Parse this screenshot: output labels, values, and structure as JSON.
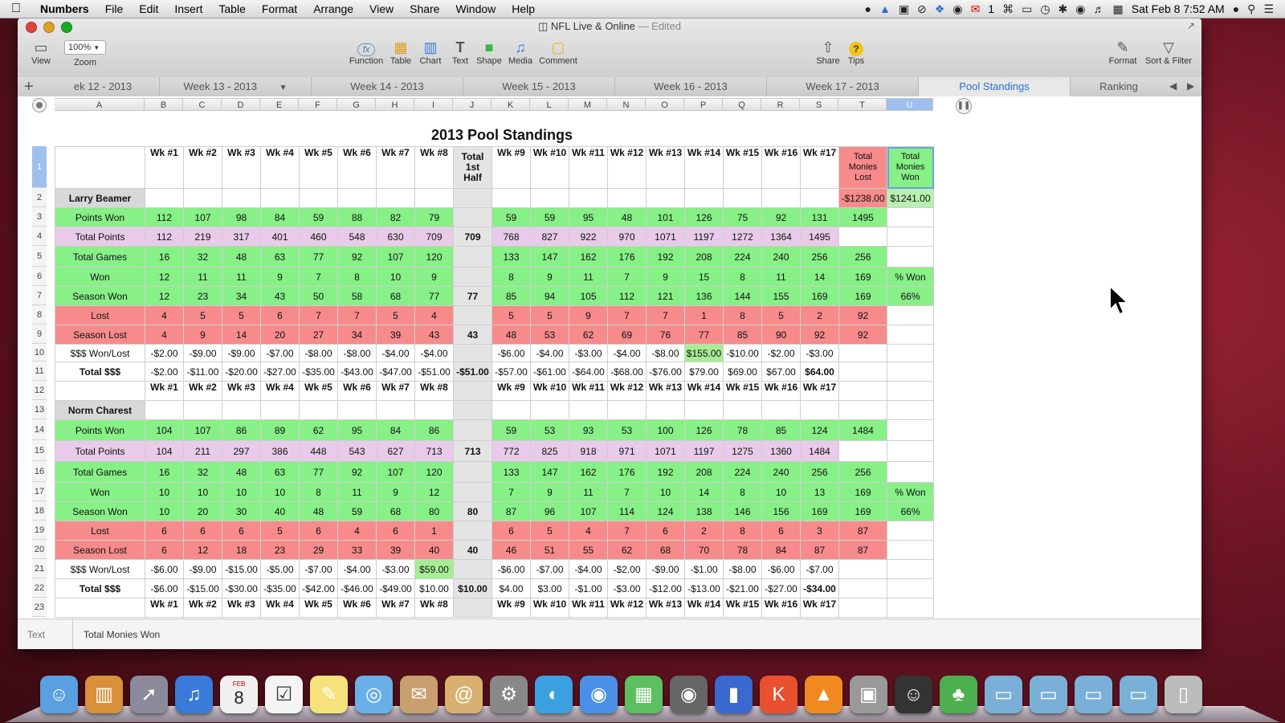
{
  "menubar": {
    "app": "Numbers",
    "items": [
      "File",
      "Edit",
      "Insert",
      "Table",
      "Format",
      "Arrange",
      "View",
      "Share",
      "Window",
      "Help"
    ],
    "badge": "1",
    "clock": "Sat Feb 8  7:52 AM"
  },
  "window": {
    "title": "NFL Live & Online",
    "edited": "— Edited"
  },
  "toolbar": {
    "view": "View",
    "zoom_value": "100%",
    "zoom": "Zoom",
    "function": "Function",
    "table": "Table",
    "chart": "Chart",
    "text": "Text",
    "shape": "Shape",
    "media": "Media",
    "comment": "Comment",
    "share": "Share",
    "tips": "Tips",
    "format": "Format",
    "sort_filter": "Sort & Filter",
    "fx": "fx"
  },
  "tabs": [
    "ek 12 - 2013",
    "Week 13 - 2013",
    "Week 14 - 2013",
    "Week 15 - 2013",
    "Week 16 - 2013",
    "Week 17 - 2013",
    "Pool Standings",
    "Ranking"
  ],
  "columns": [
    "A",
    "B",
    "C",
    "D",
    "E",
    "F",
    "G",
    "H",
    "I",
    "J",
    "K",
    "L",
    "M",
    "N",
    "O",
    "P",
    "Q",
    "R",
    "S",
    "T",
    "U"
  ],
  "row_numbers": [
    "1",
    "2",
    "3",
    "4",
    "5",
    "6",
    "7",
    "8",
    "9",
    "10",
    "11",
    "12",
    "13",
    "14",
    "15",
    "16",
    "17",
    "18",
    "19",
    "20",
    "21",
    "22",
    "23"
  ],
  "sheet_title": "2013 Pool Standings",
  "header_row": {
    "weeks_first": [
      "Wk #1",
      "Wk #2",
      "Wk #3",
      "Wk #4",
      "Wk #5",
      "Wk #6",
      "Wk #7",
      "Wk #8"
    ],
    "total_half_1": "Total",
    "total_half_2": "1st",
    "total_half_3": "Half",
    "weeks_second": [
      "Wk #9",
      "Wk #10",
      "Wk #11",
      "Wk #12",
      "Wk #13",
      "Wk #14",
      "Wk #15",
      "Wk #16",
      "Wk #17"
    ],
    "lost_1": "Total",
    "lost_2": "Monies",
    "lost_3": "Lost",
    "won_1": "Total",
    "won_2": "Monies",
    "won_3": "Won"
  },
  "player1": {
    "name": "Larry Beamer",
    "monies_lost": "-$1238.00",
    "monies_won": "$1241.00",
    "rows": {
      "points_won": {
        "label": "Points Won",
        "a": [
          "112",
          "107",
          "98",
          "84",
          "59",
          "88",
          "82",
          "79"
        ],
        "j": "",
        "b": [
          "59",
          "59",
          "95",
          "48",
          "101",
          "126",
          "75",
          "92",
          "131"
        ],
        "t": "1495",
        "u": ""
      },
      "total_points": {
        "label": "Total Points",
        "a": [
          "112",
          "219",
          "317",
          "401",
          "460",
          "548",
          "630",
          "709"
        ],
        "j": "709",
        "b": [
          "768",
          "827",
          "922",
          "970",
          "1071",
          "1197",
          "1272",
          "1364",
          "1495"
        ],
        "t": "",
        "u": ""
      },
      "total_games": {
        "label": "Total Games",
        "a": [
          "16",
          "32",
          "48",
          "63",
          "77",
          "92",
          "107",
          "120"
        ],
        "j": "",
        "b": [
          "133",
          "147",
          "162",
          "176",
          "192",
          "208",
          "224",
          "240",
          "256"
        ],
        "t": "256",
        "u": ""
      },
      "won": {
        "label": "Won",
        "a": [
          "12",
          "11",
          "11",
          "9",
          "7",
          "8",
          "10",
          "9"
        ],
        "j": "",
        "b": [
          "8",
          "9",
          "11",
          "7",
          "9",
          "15",
          "8",
          "11",
          "14"
        ],
        "t": "169",
        "u": "% Won"
      },
      "season_won": {
        "label": "Season Won",
        "a": [
          "12",
          "23",
          "34",
          "43",
          "50",
          "58",
          "68",
          "77"
        ],
        "j": "77",
        "b": [
          "85",
          "94",
          "105",
          "112",
          "121",
          "136",
          "144",
          "155",
          "169"
        ],
        "t": "169",
        "u": "66%"
      },
      "lost": {
        "label": "Lost",
        "a": [
          "4",
          "5",
          "5",
          "6",
          "7",
          "7",
          "5",
          "4"
        ],
        "j": "",
        "b": [
          "5",
          "5",
          "9",
          "7",
          "7",
          "1",
          "8",
          "5",
          "2"
        ],
        "t": "92",
        "u": ""
      },
      "season_lost": {
        "label": "Season Lost",
        "a": [
          "4",
          "9",
          "14",
          "20",
          "27",
          "34",
          "39",
          "43"
        ],
        "j": "43",
        "b": [
          "48",
          "53",
          "62",
          "69",
          "76",
          "77",
          "85",
          "90",
          "92"
        ],
        "t": "92",
        "u": ""
      },
      "won_lost": {
        "label": "$$$ Won/Lost",
        "a": [
          "-$2.00",
          "-$9.00",
          "-$9.00",
          "-$7.00",
          "-$8.00",
          "-$8.00",
          "-$4.00",
          "-$4.00"
        ],
        "j": "",
        "b": [
          "-$6.00",
          "-$4.00",
          "-$3.00",
          "-$4.00",
          "-$8.00",
          "$155.00",
          "-$10.00",
          "-$2.00",
          "-$3.00"
        ],
        "t": "",
        "u": ""
      },
      "total_money": {
        "label": "Total $$$",
        "a": [
          "-$2.00",
          "-$11.00",
          "-$20.00",
          "-$27.00",
          "-$35.00",
          "-$43.00",
          "-$47.00",
          "-$51.00"
        ],
        "j": "-$51.00",
        "b": [
          "-$57.00",
          "-$61.00",
          "-$64.00",
          "-$68.00",
          "-$76.00",
          "$79.00",
          "$69.00",
          "$67.00",
          "$64.00"
        ],
        "t": "",
        "u": ""
      }
    }
  },
  "player2": {
    "name": "Norm Charest",
    "rows": {
      "points_won": {
        "label": "Points Won",
        "a": [
          "104",
          "107",
          "86",
          "89",
          "62",
          "95",
          "84",
          "86"
        ],
        "j": "",
        "b": [
          "59",
          "53",
          "93",
          "53",
          "100",
          "126",
          "78",
          "85",
          "124"
        ],
        "t": "1484",
        "u": ""
      },
      "total_points": {
        "label": "Total Points",
        "a": [
          "104",
          "211",
          "297",
          "386",
          "448",
          "543",
          "627",
          "713"
        ],
        "j": "713",
        "b": [
          "772",
          "825",
          "918",
          "971",
          "1071",
          "1197",
          "1275",
          "1360",
          "1484"
        ],
        "t": "",
        "u": ""
      },
      "total_games": {
        "label": "Total Games",
        "a": [
          "16",
          "32",
          "48",
          "63",
          "77",
          "92",
          "107",
          "120"
        ],
        "j": "",
        "b": [
          "133",
          "147",
          "162",
          "176",
          "192",
          "208",
          "224",
          "240",
          "256"
        ],
        "t": "256",
        "u": ""
      },
      "won": {
        "label": "Won",
        "a": [
          "10",
          "10",
          "10",
          "10",
          "8",
          "11",
          "9",
          "12"
        ],
        "j": "",
        "b": [
          "7",
          "9",
          "11",
          "7",
          "10",
          "14",
          "8",
          "10",
          "13"
        ],
        "t": "169",
        "u": "% Won"
      },
      "season_won": {
        "label": "Season Won",
        "a": [
          "10",
          "20",
          "30",
          "40",
          "48",
          "59",
          "68",
          "80"
        ],
        "j": "80",
        "b": [
          "87",
          "96",
          "107",
          "114",
          "124",
          "138",
          "146",
          "156",
          "169"
        ],
        "t": "169",
        "u": "66%"
      },
      "lost": {
        "label": "Lost",
        "a": [
          "6",
          "6",
          "6",
          "5",
          "6",
          "4",
          "6",
          "1"
        ],
        "j": "",
        "b": [
          "6",
          "5",
          "4",
          "7",
          "6",
          "2",
          "8",
          "6",
          "3"
        ],
        "t": "87",
        "u": ""
      },
      "season_lost": {
        "label": "Season Lost",
        "a": [
          "6",
          "12",
          "18",
          "23",
          "29",
          "33",
          "39",
          "40"
        ],
        "j": "40",
        "b": [
          "46",
          "51",
          "55",
          "62",
          "68",
          "70",
          "78",
          "84",
          "87"
        ],
        "t": "87",
        "u": ""
      },
      "won_lost": {
        "label": "$$$ Won/Lost",
        "a": [
          "-$6.00",
          "-$9.00",
          "-$15.00",
          "-$5.00",
          "-$7.00",
          "-$4.00",
          "-$3.00",
          "$59.00"
        ],
        "j": "",
        "b": [
          "-$6.00",
          "-$7.00",
          "-$4.00",
          "-$2.00",
          "-$9.00",
          "-$1.00",
          "-$8.00",
          "-$6.00",
          "-$7.00"
        ],
        "t": "",
        "u": ""
      },
      "total_money": {
        "label": "Total $$$",
        "a": [
          "-$6.00",
          "-$15.00",
          "-$30.00",
          "-$35.00",
          "-$42.00",
          "-$46.00",
          "-$49.00",
          "$10.00"
        ],
        "j": "$10.00",
        "b": [
          "$4.00",
          "$3.00",
          "-$1.00",
          "-$3.00",
          "-$12.00",
          "-$13.00",
          "-$21.00",
          "-$27.00",
          "-$34.00"
        ],
        "t": "",
        "u": ""
      }
    }
  },
  "status_bar": {
    "cell_label": "Text",
    "formula_text": "Total Monies Won"
  },
  "dock": {
    "calendar_month": "FEB",
    "calendar_day": "8",
    "icons": [
      "finder-icon",
      "noteshelf-icon",
      "launchpad-icon",
      "itunes-icon",
      "calendar-icon",
      "reminders-icon",
      "stickies-icon",
      "preview-icon",
      "mail-icon",
      "contacts-icon",
      "system-preferences-icon",
      "dashcode-icon",
      "safari-icon",
      "numbers-app-icon",
      "facetime-icon",
      "keynote-icon",
      "kindle-icon",
      "vlc-icon",
      "image-capture-icon",
      "alfred-icon",
      "evernote-icon",
      "applications-folder-icon",
      "documents-folder-icon",
      "downloads-folder-icon",
      "folder-icon",
      "trash-icon"
    ]
  }
}
